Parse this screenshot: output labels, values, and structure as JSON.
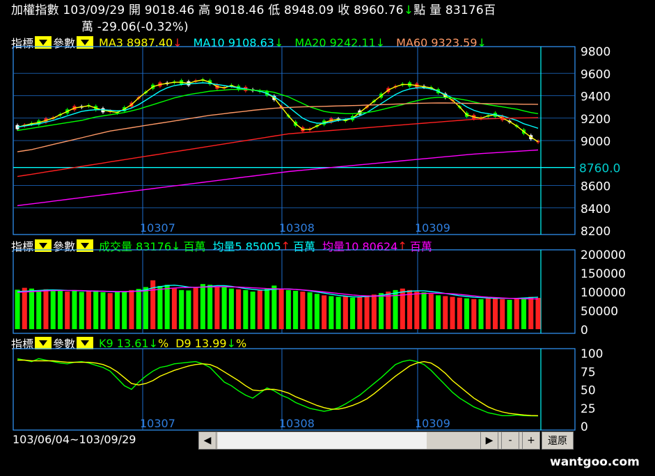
{
  "header": {
    "line1": "加權指數 103/09/29 開 9018.46 高 9018.46 低 8948.09 收 8960.76",
    "arrow": "↓",
    "line1b": "點 量 83176百",
    "line2": "萬 -29.06(-0.32%)"
  },
  "price_panel": {
    "indicator": "指標",
    "params": "參數",
    "ma3": "MA3 8987.40",
    "ma10": "MA10 9108.63",
    "ma20": "MA20 9242.11",
    "ma60": "MA60 9323.59",
    "arrow": "↓",
    "cursor_label": "8760.0"
  },
  "volume_panel": {
    "indicator": "指標",
    "params": "參數",
    "vol": "成交量 83176",
    "vol_arrow": "↓",
    "unit": "百萬",
    "avg5": "均量5 85005",
    "avg5_arrow": "↑",
    "avg10": "均量10 80624",
    "avg10_arrow": "↑"
  },
  "kd_panel": {
    "indicator": "指標",
    "params": "參數",
    "k": "K9 13.61",
    "d": "D9 13.99",
    "arrow": "↓",
    "pct": "%"
  },
  "footer": {
    "range": "103/06/04~103/09/29",
    "btn_left": "◀",
    "btn_right": "▶",
    "btn_minus": "-",
    "btn_plus": "+",
    "btn_reset": "還原",
    "watermark": "wantgoo.com"
  },
  "chart_data": [
    {
      "type": "candlestick",
      "yticks": [
        9800,
        9600,
        9400,
        9200,
        9000,
        8760.0,
        8600,
        8400,
        8200
      ],
      "ylim": [
        8200,
        9800
      ],
      "x_month_labels": [
        "10307",
        "10308",
        "10309"
      ],
      "series": [
        {
          "name": "MA3",
          "color": "#ffff00",
          "values": [
            9120,
            9135,
            9150,
            9160,
            9180,
            9200,
            9230,
            9260,
            9290,
            9300,
            9310,
            9290,
            9270,
            9260,
            9250,
            9280,
            9320,
            9380,
            9430,
            9480,
            9500,
            9510,
            9520,
            9520,
            9510,
            9530,
            9540,
            9520,
            9480,
            9470,
            9490,
            9470,
            9460,
            9450,
            9440,
            9420,
            9380,
            9300,
            9220,
            9150,
            9100,
            9100,
            9130,
            9160,
            9180,
            9190,
            9180,
            9200,
            9250,
            9300,
            9350,
            9400,
            9450,
            9480,
            9500,
            9500,
            9490,
            9480,
            9470,
            9440,
            9400,
            9360,
            9300,
            9230,
            9210,
            9200,
            9220,
            9230,
            9200,
            9170,
            9130,
            9080,
            9030,
            8990
          ]
        },
        {
          "name": "MA10",
          "color": "#00ffff",
          "values": [
            9120,
            9130,
            9140,
            9150,
            9165,
            9180,
            9200,
            9220,
            9240,
            9260,
            9270,
            9275,
            9275,
            9270,
            9265,
            9270,
            9290,
            9320,
            9360,
            9400,
            9440,
            9470,
            9490,
            9500,
            9505,
            9510,
            9515,
            9510,
            9500,
            9490,
            9480,
            9470,
            9460,
            9450,
            9440,
            9420,
            9390,
            9350,
            9300,
            9250,
            9200,
            9170,
            9155,
            9155,
            9165,
            9180,
            9190,
            9200,
            9220,
            9250,
            9290,
            9330,
            9370,
            9410,
            9440,
            9460,
            9470,
            9470,
            9460,
            9440,
            9410,
            9380,
            9340,
            9300,
            9270,
            9250,
            9240,
            9230,
            9220,
            9200,
            9180,
            9150,
            9130,
            9110
          ]
        },
        {
          "name": "MA20",
          "color": "#00ff00",
          "values": [
            9090,
            9100,
            9110,
            9120,
            9130,
            9140,
            9150,
            9160,
            9170,
            9180,
            9195,
            9210,
            9220,
            9230,
            9240,
            9250,
            9265,
            9280,
            9300,
            9320,
            9340,
            9360,
            9380,
            9395,
            9410,
            9420,
            9430,
            9440,
            9445,
            9450,
            9455,
            9455,
            9455,
            9450,
            9445,
            9440,
            9430,
            9410,
            9390,
            9360,
            9330,
            9300,
            9280,
            9260,
            9250,
            9245,
            9240,
            9240,
            9245,
            9250,
            9260,
            9275,
            9290,
            9305,
            9320,
            9340,
            9355,
            9370,
            9380,
            9385,
            9385,
            9380,
            9370,
            9360,
            9345,
            9330,
            9320,
            9310,
            9300,
            9290,
            9280,
            9265,
            9250,
            9240
          ]
        },
        {
          "name": "MA60",
          "color": "#ff9966",
          "values": [
            8900,
            8910,
            8920,
            8935,
            8950,
            8965,
            8980,
            8995,
            9010,
            9025,
            9040,
            9055,
            9070,
            9085,
            9095,
            9105,
            9115,
            9125,
            9135,
            9145,
            9155,
            9165,
            9175,
            9185,
            9195,
            9205,
            9215,
            9225,
            9232,
            9240,
            9248,
            9255,
            9262,
            9270,
            9276,
            9282,
            9288,
            9292,
            9295,
            9298,
            9300,
            9302,
            9303,
            9305,
            9307,
            9309,
            9310,
            9312,
            9314,
            9316,
            9318,
            9320,
            9322,
            9325,
            9327,
            9330,
            9332,
            9333,
            9334,
            9335,
            9335,
            9334,
            9333,
            9332,
            9331,
            9330,
            9329,
            9328,
            9327,
            9326,
            9325,
            9324,
            9324,
            9323
          ]
        },
        {
          "name": "",
          "color": "#ff2020",
          "values": [
            8680,
            8690,
            8700,
            8710,
            8720,
            8730,
            8740,
            8750,
            8760,
            8770,
            8780,
            8790,
            8800,
            8810,
            8820,
            8830,
            8840,
            8850,
            8860,
            8870,
            8880,
            8890,
            8900,
            8910,
            8920,
            8930,
            8940,
            8950,
            8960,
            8970,
            8980,
            8990,
            9000,
            9010,
            9020,
            9030,
            9040,
            9050,
            9060,
            9065,
            9070,
            9075,
            9080,
            9085,
            9090,
            9095,
            9100,
            9105,
            9110,
            9115,
            9120,
            9125,
            9130,
            9135,
            9140,
            9145,
            9150,
            9155,
            9160,
            9165,
            9170,
            9175,
            9180,
            9185,
            9190,
            9192,
            9194,
            9196,
            9198,
            9200,
            9201,
            9202,
            9203,
            9204
          ]
        },
        {
          "name": "",
          "color": "#ff00ff",
          "values": [
            8420,
            8428,
            8436,
            8444,
            8452,
            8460,
            8468,
            8476,
            8484,
            8492,
            8500,
            8508,
            8516,
            8524,
            8532,
            8540,
            8548,
            8556,
            8564,
            8572,
            8580,
            8588,
            8596,
            8604,
            8612,
            8620,
            8628,
            8636,
            8644,
            8652,
            8660,
            8668,
            8676,
            8684,
            8692,
            8700,
            8708,
            8716,
            8724,
            8730,
            8736,
            8742,
            8748,
            8754,
            8760,
            8766,
            8772,
            8778,
            8784,
            8790,
            8796,
            8802,
            8808,
            8814,
            8820,
            8826,
            8832,
            8838,
            8844,
            8850,
            8856,
            8862,
            8868,
            8874,
            8880,
            8884,
            8888,
            8892,
            8896,
            8900,
            8904,
            8908,
            8912,
            8916
          ]
        }
      ]
    },
    {
      "type": "bar",
      "name": "成交量",
      "yticks": [
        200000,
        150000,
        100000,
        50000,
        0
      ],
      "ylim": [
        0,
        200000
      ],
      "values": [
        105000,
        110000,
        108000,
        103000,
        106000,
        104000,
        102000,
        100000,
        104000,
        99000,
        101000,
        103000,
        98000,
        96000,
        100000,
        101000,
        104000,
        107000,
        112000,
        130000,
        115000,
        118000,
        108000,
        104000,
        103000,
        110000,
        120000,
        118000,
        112000,
        114000,
        108000,
        106000,
        104000,
        100000,
        103000,
        109000,
        116000,
        108000,
        104000,
        102000,
        100000,
        98000,
        94000,
        90000,
        88000,
        86000,
        88000,
        84000,
        86000,
        90000,
        92000,
        96000,
        100000,
        104000,
        108000,
        104000,
        100000,
        98000,
        94000,
        90000,
        88000,
        86000,
        84000,
        82000,
        80000,
        80000,
        82000,
        84000,
        80000,
        78000,
        82000,
        84000,
        86000,
        83176
      ],
      "series": [
        {
          "name": "均量5",
          "color": "#00ffff",
          "values": [
            100000,
            101000,
            102000,
            103000,
            104000,
            104500,
            104000,
            103000,
            102500,
            102000,
            101500,
            101000,
            101000,
            100000,
            99500,
            99500,
            100500,
            102000,
            104500,
            110000,
            113000,
            116000,
            117000,
            115000,
            112000,
            111000,
            112000,
            114000,
            116000,
            116000,
            114000,
            111000,
            108000,
            106000,
            104000,
            104000,
            106000,
            107000,
            107000,
            106000,
            104000,
            102000,
            99000,
            96000,
            93000,
            90000,
            88000,
            86000,
            86000,
            87000,
            88000,
            90000,
            93000,
            96000,
            99000,
            101000,
            102000,
            102000,
            100000,
            98000,
            95000,
            92000,
            89000,
            87000,
            85000,
            84000,
            83000,
            82000,
            82000,
            82000,
            82000,
            83000,
            84000,
            85005
          ]
        },
        {
          "name": "均量10",
          "color": "#ff00ff",
          "values": [
            98000,
            99000,
            100000,
            101000,
            102000,
            102500,
            103000,
            103000,
            103000,
            102500,
            102000,
            101500,
            101000,
            100500,
            100000,
            100000,
            100500,
            101000,
            102000,
            104000,
            106000,
            108000,
            109500,
            110500,
            111000,
            111500,
            112000,
            112500,
            113000,
            113000,
            112500,
            112000,
            111000,
            110000,
            109000,
            108000,
            107500,
            107000,
            106500,
            106000,
            104500,
            103000,
            101000,
            99000,
            97000,
            95000,
            93000,
            91000,
            89500,
            88500,
            88000,
            88000,
            88500,
            89500,
            91000,
            92500,
            94000,
            95000,
            95500,
            95500,
            95000,
            94000,
            92500,
            90500,
            88500,
            86500,
            85000,
            84000,
            83000,
            82000,
            81500,
            81000,
            80800,
            80624
          ]
        }
      ]
    },
    {
      "type": "line",
      "name": "KD",
      "yticks": [
        100,
        75,
        50,
        25,
        0
      ],
      "ylim": [
        0,
        100
      ],
      "x_month_labels": [
        "10307",
        "10308",
        "10309"
      ],
      "series": [
        {
          "name": "K9",
          "color": "#00ff00",
          "values": [
            92,
            90,
            88,
            92,
            90,
            88,
            86,
            85,
            87,
            88,
            86,
            83,
            80,
            75,
            65,
            55,
            50,
            60,
            68,
            75,
            80,
            82,
            85,
            86,
            87,
            88,
            85,
            80,
            70,
            60,
            55,
            48,
            42,
            38,
            45,
            52,
            48,
            42,
            38,
            32,
            28,
            24,
            22,
            20,
            22,
            25,
            30,
            36,
            42,
            50,
            58,
            66,
            75,
            84,
            88,
            90,
            88,
            84,
            76,
            66,
            56,
            46,
            38,
            32,
            26,
            22,
            18,
            16,
            14,
            14,
            15,
            14,
            13.8,
            13.61
          ]
        },
        {
          "name": "D9",
          "color": "#ffff00",
          "values": [
            90,
            90,
            89,
            89,
            89,
            89,
            88,
            87,
            87,
            87,
            87,
            86,
            84,
            80,
            74,
            66,
            58,
            56,
            58,
            62,
            68,
            72,
            76,
            79,
            82,
            84,
            85,
            84,
            80,
            74,
            68,
            62,
            55,
            49,
            48,
            50,
            50,
            48,
            45,
            40,
            36,
            32,
            28,
            25,
            23,
            23,
            25,
            28,
            32,
            37,
            44,
            52,
            60,
            68,
            75,
            82,
            86,
            88,
            86,
            80,
            72,
            62,
            54,
            46,
            38,
            32,
            26,
            22,
            19,
            17,
            16,
            15,
            14.2,
            13.99
          ]
        }
      ]
    }
  ]
}
